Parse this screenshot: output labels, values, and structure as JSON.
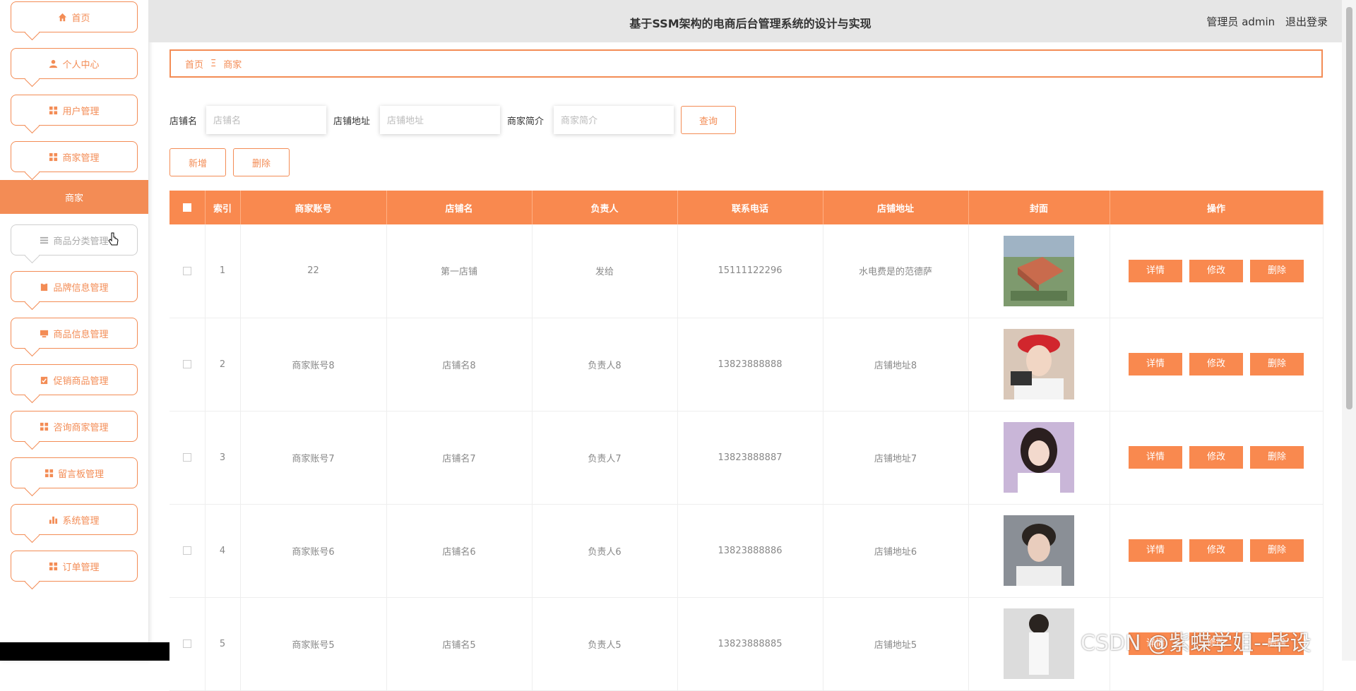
{
  "header": {
    "title": "基于SSM架构的电商后台管理系统的设计与实现",
    "user_label": "管理员 admin",
    "logout_label": "退出登录"
  },
  "sidebar": {
    "items": [
      {
        "label": "首页",
        "icon": "home-icon"
      },
      {
        "label": "个人中心",
        "icon": "user-icon"
      },
      {
        "label": "用户管理",
        "icon": "grid-icon"
      },
      {
        "label": "商家管理",
        "icon": "grid-icon"
      },
      {
        "label": "商品分类管理",
        "icon": "list-icon"
      },
      {
        "label": "品牌信息管理",
        "icon": "clipboard-icon"
      },
      {
        "label": "商品信息管理",
        "icon": "monitor-icon"
      },
      {
        "label": "促销商品管理",
        "icon": "clipboard-check-icon"
      },
      {
        "label": "咨询商家管理",
        "icon": "grid-icon"
      },
      {
        "label": "留言板管理",
        "icon": "grid-icon"
      },
      {
        "label": "系统管理",
        "icon": "bar-chart-icon"
      },
      {
        "label": "订单管理",
        "icon": "grid-icon"
      }
    ],
    "active_submenu": "商家"
  },
  "breadcrumb": {
    "home": "首页",
    "separator": "Ξ",
    "current": "商家"
  },
  "search": {
    "shop_name_label": "店铺名",
    "shop_name_placeholder": "店铺名",
    "shop_address_label": "店铺地址",
    "shop_address_placeholder": "店铺地址",
    "intro_label": "商家简介",
    "intro_placeholder": "商家简介",
    "query_button": "查询"
  },
  "toolbar": {
    "add_label": "新增",
    "delete_label": "删除"
  },
  "table": {
    "columns": [
      "索引",
      "商家账号",
      "店铺名",
      "负责人",
      "联系电话",
      "店铺地址",
      "封面",
      "操作"
    ],
    "actions": {
      "detail": "详情",
      "edit": "修改",
      "delete": "删除"
    },
    "rows": [
      {
        "index": "1",
        "account": "22",
        "shop": "第一店铺",
        "manager": "发给",
        "phone": "15111122296",
        "address": "水电费是的范德萨"
      },
      {
        "index": "2",
        "account": "商家账号8",
        "shop": "店铺名8",
        "manager": "负责人8",
        "phone": "13823888888",
        "address": "店铺地址8"
      },
      {
        "index": "3",
        "account": "商家账号7",
        "shop": "店铺名7",
        "manager": "负责人7",
        "phone": "13823888887",
        "address": "店铺地址7"
      },
      {
        "index": "4",
        "account": "商家账号6",
        "shop": "店铺名6",
        "manager": "负责人6",
        "phone": "13823888886",
        "address": "店铺地址6"
      },
      {
        "index": "5",
        "account": "商家账号5",
        "shop": "店铺名5",
        "manager": "负责人5",
        "phone": "13823888885",
        "address": "店铺地址5"
      }
    ]
  },
  "watermark": "CSDN @紫蝶学姐--毕设",
  "colors": {
    "accent": "#f9894f",
    "header_bg": "#e6e6e6"
  }
}
